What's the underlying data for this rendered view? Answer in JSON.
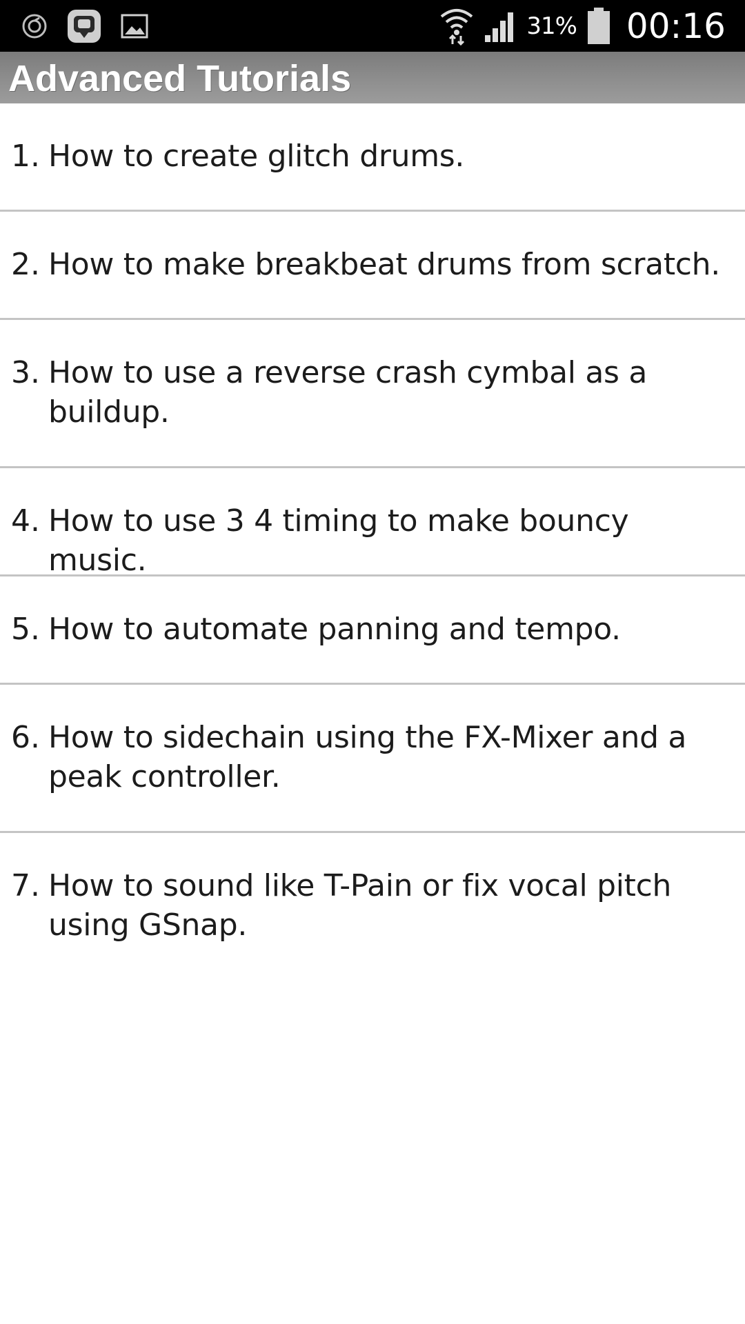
{
  "status_bar": {
    "left_icons": [
      "sync-icon",
      "app-notification-icon",
      "image-icon"
    ],
    "right_icons": [
      "wifi-icon",
      "signal-icon",
      "battery-icon"
    ],
    "battery_percent": "31%",
    "time": "00:16"
  },
  "action_bar": {
    "title": "Advanced Tutorials"
  },
  "tutorials": [
    {
      "number": "1.",
      "title": "How to create glitch drums."
    },
    {
      "number": "2.",
      "title": "How to make breakbeat drums from scratch."
    },
    {
      "number": "3.",
      "title": "How to use a reverse crash cymbal as a buildup."
    },
    {
      "number": "4.",
      "title": "How to use 3 4 timing to make bouncy music."
    },
    {
      "number": "5.",
      "title": "How to automate panning and tempo."
    },
    {
      "number": "6.",
      "title": "How to sidechain using the FX-Mixer and a peak controller."
    },
    {
      "number": "7.",
      "title": "How to sound like T-Pain or fix vocal pitch using GSnap."
    }
  ],
  "colors": {
    "status_bar_bg": "#000000",
    "action_bar_bg": "#8e8e8e",
    "list_bg": "#ffffff",
    "divider": "#c4c4c4",
    "text": "#1c1c1c"
  }
}
